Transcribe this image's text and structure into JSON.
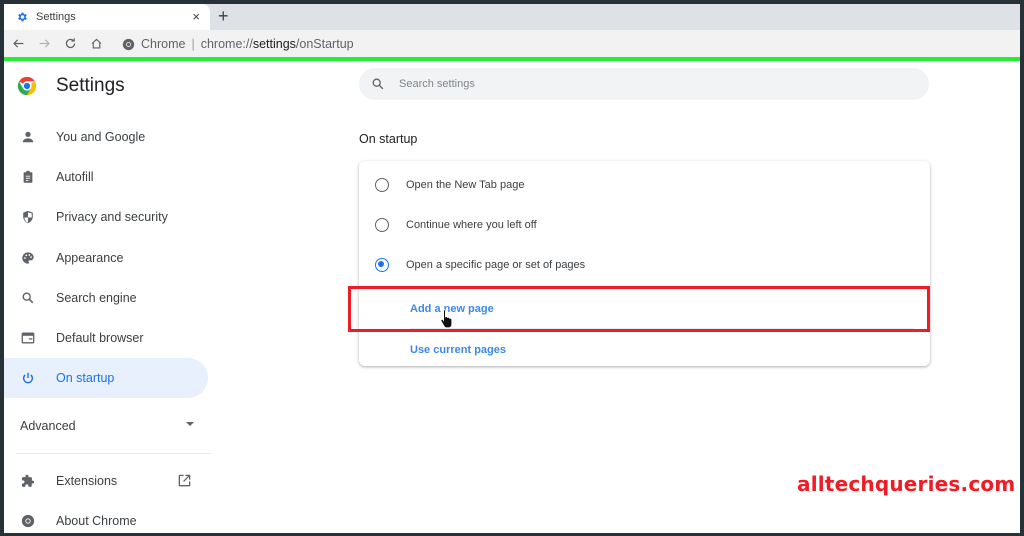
{
  "browser": {
    "tab": {
      "title": "Settings",
      "close_label": "×"
    },
    "new_tab_label": "+",
    "omnibox": {
      "site": "Chrome",
      "separator": "|",
      "url_prefix": "chrome://",
      "url_bold": "settings",
      "url_suffix": "/onStartup"
    },
    "accent_bar_color": "#22ee33"
  },
  "sidebar": {
    "title": "Settings",
    "items": [
      {
        "label": "You and Google",
        "icon": "person-icon",
        "active": false
      },
      {
        "label": "Autofill",
        "icon": "clipboard-icon",
        "active": false
      },
      {
        "label": "Privacy and security",
        "icon": "shield-icon",
        "active": false
      },
      {
        "label": "Appearance",
        "icon": "palette-icon",
        "active": false
      },
      {
        "label": "Search engine",
        "icon": "search-icon",
        "active": false
      },
      {
        "label": "Default browser",
        "icon": "browser-window-icon",
        "active": false
      },
      {
        "label": "On startup",
        "icon": "power-icon",
        "active": true
      }
    ],
    "advanced_label": "Advanced",
    "extensions_label": "Extensions",
    "about_label": "About Chrome"
  },
  "main": {
    "search_placeholder": "Search settings",
    "section_title": "On startup",
    "options": [
      {
        "label": "Open the New Tab page",
        "checked": false
      },
      {
        "label": "Continue where you left off",
        "checked": false
      },
      {
        "label": "Open a specific page or set of pages",
        "checked": true
      }
    ],
    "links": {
      "add_page": "Add a new page",
      "use_current": "Use current pages"
    }
  },
  "watermark": "alltechqueries.com",
  "colors": {
    "accent": "#1a73e8",
    "highlight_box": "#ee1c25",
    "active_bg": "#e8f0fe"
  }
}
